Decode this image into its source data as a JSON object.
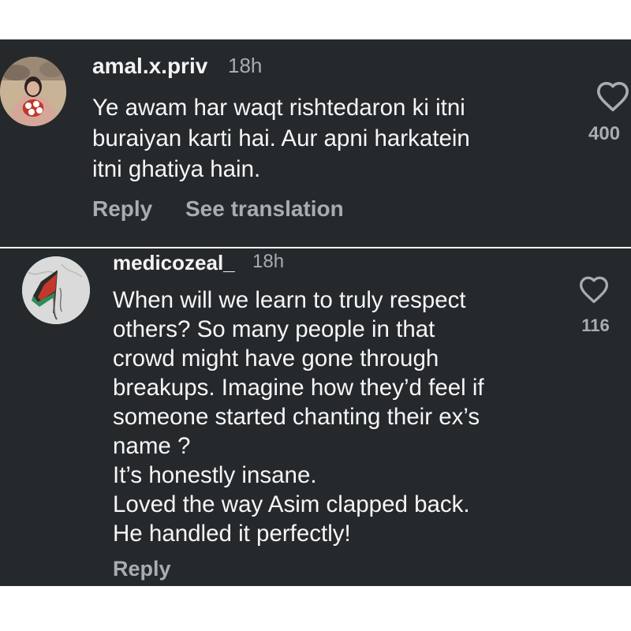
{
  "comments": [
    {
      "username": "amal.x.priv",
      "timestamp": "18h",
      "text": "Ye awam har waqt rishtedaron ki itni\nburaiyan karti hai. Aur apni harkatein\nitni ghatiya hain.",
      "likes": "400",
      "reply_label": "Reply",
      "translate_label": "See translation",
      "avatar_icon": "user-avatar-photo"
    },
    {
      "username": "medicozeal_",
      "timestamp": "18h",
      "text": "When will we learn to truly respect\nothers? So many people in that\ncrowd might have gone through\nbreakups. Imagine how they’d feel if\nsomeone started chanting their ex’s\nname ?\nIt’s honestly insane.\nLoved the way Asim clapped back.\nHe handled it perfectly!",
      "likes": "116",
      "reply_label": "Reply",
      "avatar_icon": "palestine-flag-avatar"
    }
  ],
  "colors": {
    "panel_bg": "#25292c",
    "text_primary": "#f5f6f8",
    "text_secondary": "#a8adb4",
    "page_bg": "#ffffff"
  },
  "icons": {
    "like": "heart-outline-icon"
  }
}
